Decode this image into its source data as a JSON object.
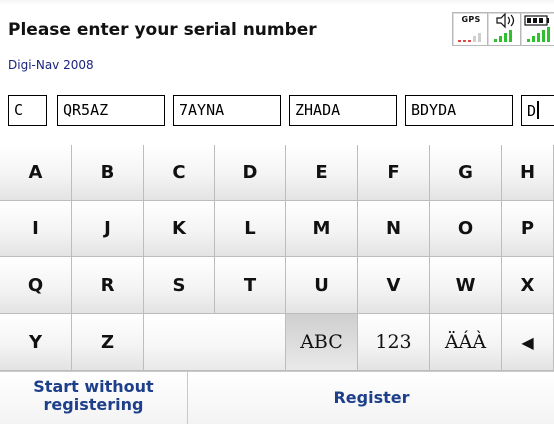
{
  "header": {
    "title": "Please enter your serial number",
    "subtitle": "Digi-Nav 2008"
  },
  "status": {
    "gps_label": "GPS",
    "sound_icon": "speaker-icon",
    "battery_icon": "battery-icon",
    "signal_color": "#2fbf2f",
    "no_signal_color": "#e04848"
  },
  "serial_fields": [
    "C",
    "QR5AZ",
    "7AYNA",
    "ZHADA",
    "BDYDA",
    "D"
  ],
  "keyboard": {
    "rows": [
      [
        "A",
        "B",
        "C",
        "D",
        "E",
        "F",
        "G",
        "H"
      ],
      [
        "I",
        "J",
        "K",
        "L",
        "M",
        "N",
        "O",
        "P"
      ],
      [
        "Q",
        "R",
        "S",
        "T",
        "U",
        "V",
        "W",
        "X"
      ]
    ],
    "last_row": {
      "letters": [
        "Y",
        "Z"
      ],
      "abc": "ABC",
      "num": "123",
      "accent": "ÄÁÀ",
      "backspace": "◀"
    }
  },
  "buttons": {
    "start_line1": "Start without",
    "start_line2": "registering",
    "register": "Register"
  }
}
